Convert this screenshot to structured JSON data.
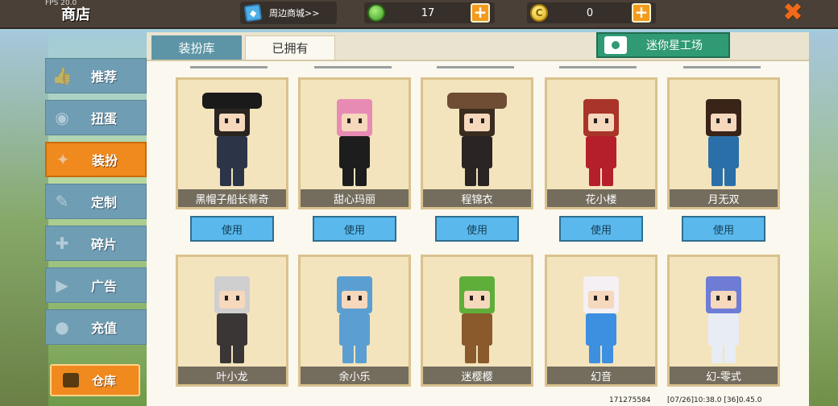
{
  "topbar": {
    "fps": "FPS 20.0",
    "title": "商店",
    "merch_label": "周边商城>>",
    "gems": "17",
    "coins": "0",
    "plus": "+",
    "close": "✖"
  },
  "sidebar": {
    "items": [
      {
        "label": "推荐"
      },
      {
        "label": "扭蛋"
      },
      {
        "label": "装扮"
      },
      {
        "label": "定制"
      },
      {
        "label": "碎片"
      },
      {
        "label": "广告"
      },
      {
        "label": "充值"
      }
    ],
    "warehouse_label": "仓库"
  },
  "tabs": [
    {
      "label": "装扮库"
    },
    {
      "label": "已拥有"
    }
  ],
  "workshop_label": "迷你星工场",
  "use_label": "使用",
  "skins_row1": [
    {
      "name": "黑帽子船长蒂奇",
      "hair": "#2a2520",
      "outfit": "#2c3448",
      "hat": "#1a1a1a"
    },
    {
      "name": "甜心玛丽",
      "hair": "#e88bb4",
      "outfit": "#1d1d1d",
      "hat": ""
    },
    {
      "name": "程锦衣",
      "hair": "#3b2c20",
      "outfit": "#2a2424",
      "hat": "#6e4d34"
    },
    {
      "name": "花小楼",
      "hair": "#a8342a",
      "outfit": "#b51f2c",
      "hat": ""
    },
    {
      "name": "月无双",
      "hair": "#3a2418",
      "outfit": "#2b6fa8",
      "hat": ""
    }
  ],
  "skins_row2": [
    {
      "name": "叶小龙",
      "hair": "#cfcfcf",
      "outfit": "#3a3636",
      "hat": ""
    },
    {
      "name": "余小乐",
      "hair": "#5b9fd2",
      "outfit": "#5b9fd2",
      "hat": ""
    },
    {
      "name": "迷樱樱",
      "hair": "#5fae3a",
      "outfit": "#8a5a2c",
      "hat": ""
    },
    {
      "name": "幻音",
      "hair": "#f4f0f4",
      "outfit": "#3d8fe0",
      "hat": ""
    },
    {
      "name": "幻-零式",
      "hair": "#6e7cd6",
      "outfit": "#e8ecf4",
      "hat": ""
    }
  ],
  "footer": {
    "left": "171275584",
    "right": "[07/26]10:38.0 [36]0.45.0"
  }
}
